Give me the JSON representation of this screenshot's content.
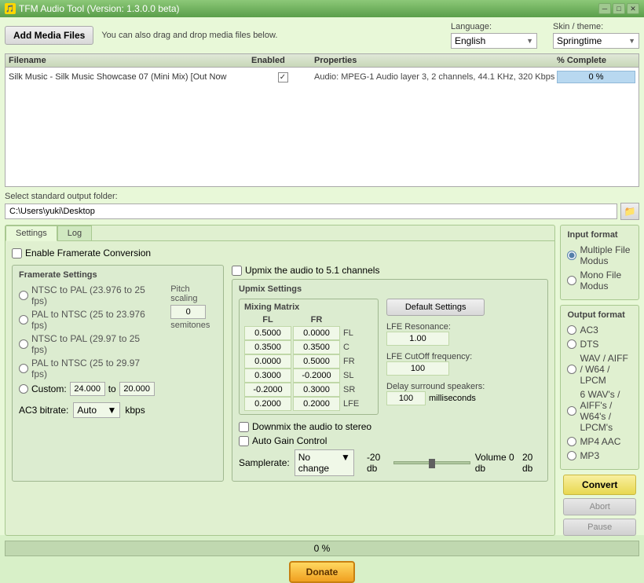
{
  "titleBar": {
    "title": "TFM Audio Tool  (Version: 1.3.0.0 beta)",
    "minBtn": "─",
    "maxBtn": "□",
    "closeBtn": "✕"
  },
  "header": {
    "addFilesBtn": "Add Media Files",
    "dragHint": "You can also drag and drop media files below.",
    "languageLabel": "Language:",
    "languageValue": "English",
    "skinLabel": "Skin / theme:",
    "skinValue": "Springtime"
  },
  "fileList": {
    "columns": [
      "Filename",
      "Enabled",
      "Properties",
      "% Complete"
    ],
    "rows": [
      {
        "filename": "Silk Music - Silk Music Showcase 07 (Mini Mix) [Out Now",
        "enabled": true,
        "properties": "Audio: MPEG-1 Audio layer 3, 2 channels, 44.1 KHz, 320 Kbps",
        "progress": "0 %"
      }
    ]
  },
  "outputFolder": {
    "label": "Select standard output folder:",
    "path": "C:\\Users\\yuki\\Desktop"
  },
  "tabs": [
    "Settings",
    "Log"
  ],
  "settings": {
    "enableFramerateLabel": "Enable Framerate Conversion",
    "framerateBox": {
      "title": "Framerate Settings",
      "options": [
        "NTSC to PAL (23.976 to 25 fps)",
        "PAL to NTSC (25 to 23.976 fps)",
        "NTSC to PAL (29.97 to 25 fps)",
        "PAL to NTSC (25 to 29.97 fps)"
      ],
      "customLabel": "Custom:",
      "customFrom": "24.000",
      "customTo": "20.000",
      "pitchLabel": "Pitch scaling",
      "pitchValue": "0",
      "semitonesLabel": "semitones"
    },
    "ac3": {
      "label": "AC3 bitrate:",
      "value": "Auto",
      "unit": "kbps"
    }
  },
  "upmix": {
    "enableLabel": "Upmix the audio to 5.1 channels",
    "boxTitle": "Upmix Settings",
    "mixingMatrix": {
      "title": "Mixing Matrix",
      "colHeaders": [
        "FL",
        "FR"
      ],
      "rows": [
        {
          "values": [
            "0.5000",
            "0.0000"
          ],
          "label": "FL"
        },
        {
          "values": [
            "0.3500",
            "0.3500"
          ],
          "label": "C"
        },
        {
          "values": [
            "0.0000",
            "0.5000"
          ],
          "label": "FR"
        },
        {
          "values": [
            "0.3000",
            "-0.2000"
          ],
          "label": "SL"
        },
        {
          "values": [
            "-0.2000",
            "0.3000"
          ],
          "label": "SR"
        },
        {
          "values": [
            "0.2000",
            "0.2000"
          ],
          "label": "LFE"
        }
      ]
    },
    "defaultSettingsBtn": "Default Settings",
    "lfeResonanceLabel": "LFE Resonance:",
    "lfeResonanceValue": "1.00",
    "lfeCutoffLabel": "LFE CutOff frequency:",
    "lfeCutoffValue": "100",
    "delaySurroundLabel": "Delay surround speakers:",
    "delaySurroundValue": "100",
    "delayUnit": "milliseconds",
    "downmixLabel": "Downmix the audio to stereo",
    "autoGainLabel": "Auto Gain Control",
    "samplerateLabel": "Samplerate:",
    "samplerateValue": "No change",
    "volumeMin": "-20 db",
    "volumeCenter": "Volume 0 db",
    "volumeMax": "20 db"
  },
  "inputFormat": {
    "title": "Input format",
    "options": [
      {
        "label": "Multiple File Modus",
        "selected": true
      },
      {
        "label": "Mono File Modus",
        "selected": false
      }
    ]
  },
  "outputFormat": {
    "title": "Output format",
    "options": [
      {
        "label": "AC3",
        "selected": false
      },
      {
        "label": "DTS",
        "selected": false
      },
      {
        "label": "WAV / AIFF / W64 / LPCM",
        "selected": false
      },
      {
        "label": "6 WAV's / AIFF's / W64's / LPCM's",
        "selected": false
      },
      {
        "label": "MP4 AAC",
        "selected": false
      },
      {
        "label": "MP3",
        "selected": false
      }
    ]
  },
  "actions": {
    "convertBtn": "Convert",
    "abortBtn": "Abort",
    "pauseBtn": "Pause"
  },
  "progressBar": {
    "value": "0 %"
  },
  "donateBtn": "Donate"
}
